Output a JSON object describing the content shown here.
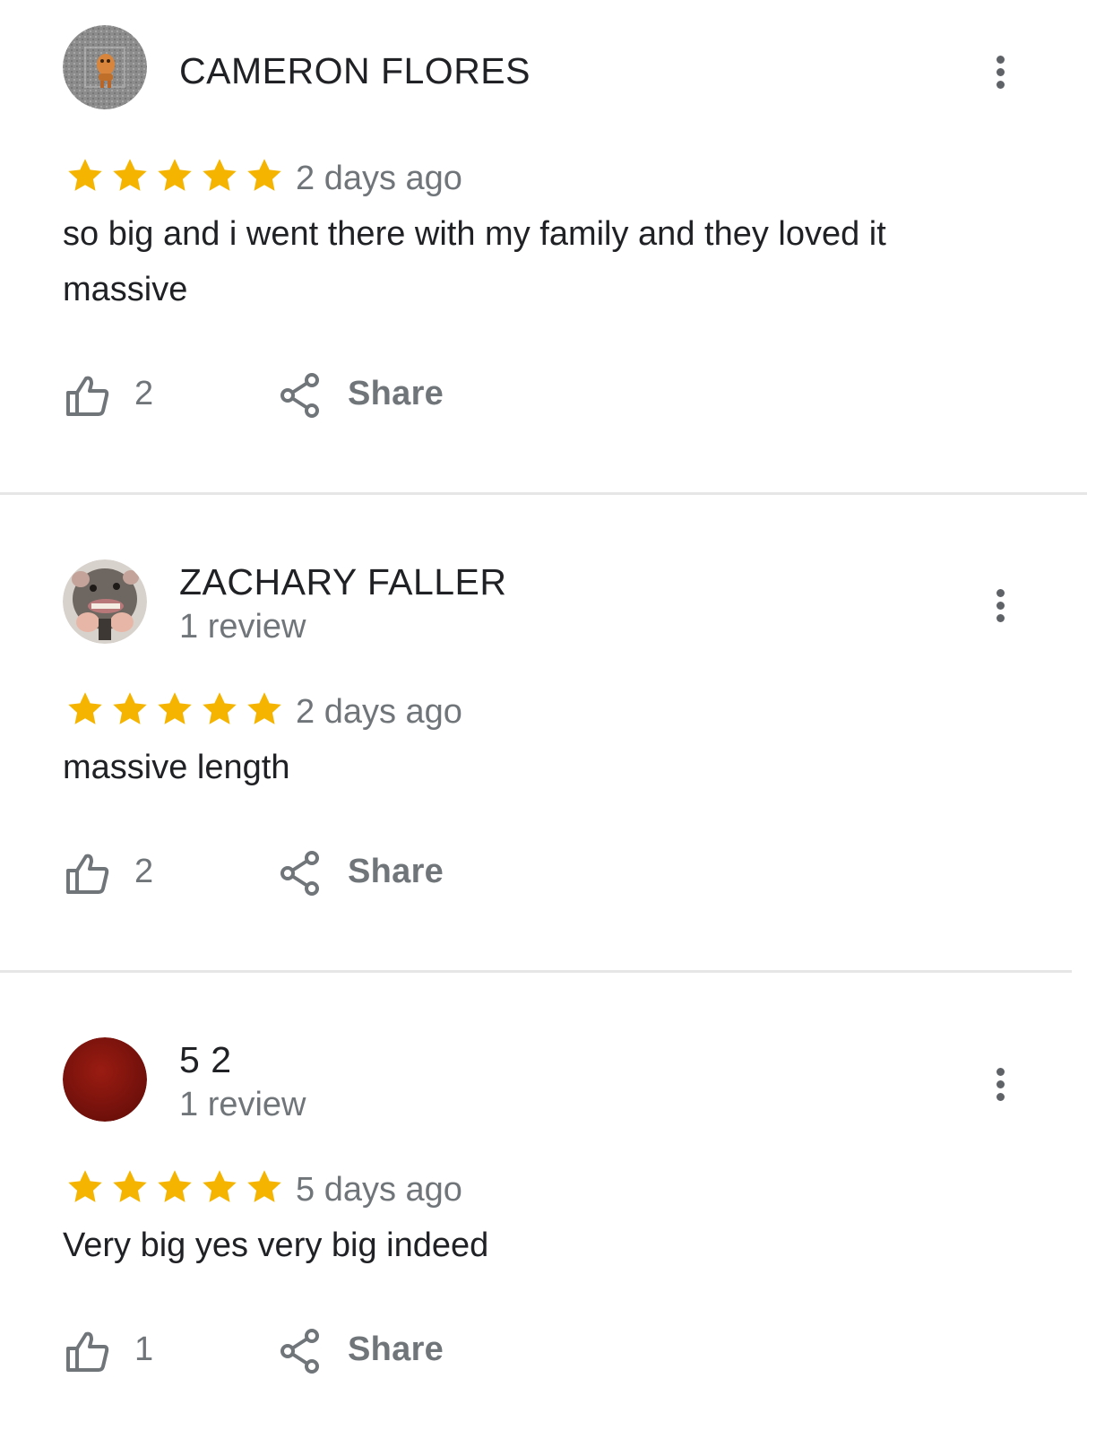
{
  "reviews": [
    {
      "name": "CAMERON FLORES",
      "subtitle": "",
      "rating": 5,
      "time_ago": "2 days ago",
      "text": "so big and i went there with my family and they loved it massive",
      "likes": "2",
      "share_label": "Share",
      "avatar": "gray-textured-avatar-with-small-figure"
    },
    {
      "name": "ZACHARY FALLER",
      "subtitle": "1 review",
      "rating": 5,
      "time_ago": "2 days ago",
      "text": "massive length",
      "likes": "2",
      "share_label": "Share",
      "avatar": "rat-face-photo-avatar"
    },
    {
      "name": "5 2",
      "subtitle": "1 review",
      "rating": 5,
      "time_ago": "5 days ago",
      "text": "Very big yes very big indeed",
      "likes": "1",
      "share_label": "Share",
      "avatar": "dark-red-circle-avatar"
    }
  ],
  "colors": {
    "star": "#F4B400",
    "muted_text": "#70757a",
    "primary_text": "#202124",
    "divider": "#e6e6e6",
    "icon": "#70757a"
  },
  "icons": {
    "like": "thumb-up-outline-icon",
    "share": "share-icon",
    "menu": "more-vert-icon",
    "star": "star-icon"
  }
}
